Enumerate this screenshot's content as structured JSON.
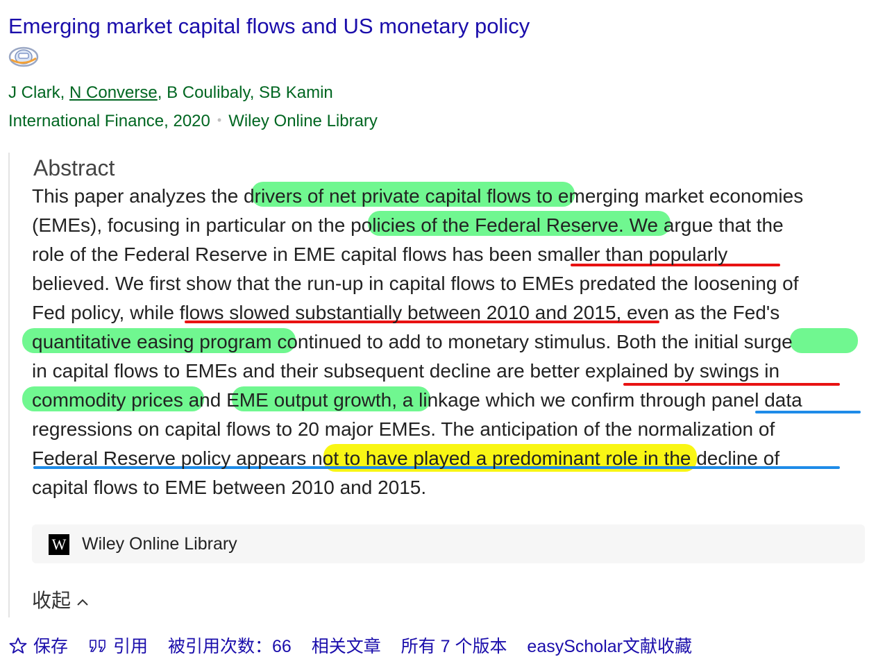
{
  "result": {
    "title": "Emerging market capital flows and US monetary policy",
    "authors": {
      "a1": "J Clark",
      "a2": "N Converse",
      "a3": "B Coulibaly",
      "a4": "SB Kamin",
      "sep": ", "
    },
    "venue": {
      "journal_year": "International Finance, 2020",
      "dot": "•",
      "library": "Wiley Online Library"
    }
  },
  "abstract": {
    "heading": "Abstract",
    "lines": [
      "This paper analyzes the drivers of net private capital flows to emerging market economies",
      "(EMEs), focusing in particular on the policies of the Federal Reserve. We argue that the",
      "role of the Federal Reserve in EME capital flows has been smaller than popularly",
      "believed. We first show that the run-up in capital flows to EMEs predated the loosening of",
      "Fed policy, while flows slowed substantially between 2010 and 2015, even as the Fed's",
      "quantitative easing program continued to add to monetary stimulus. Both the initial surge",
      "in capital flows to EMEs and their subsequent decline are better explained by swings in",
      "commodity prices and EME output growth, a linkage which we confirm through panel data",
      "regressions on capital flows to 20 major EMEs. The anticipation of the normalization of",
      "Federal Reserve policy appears not to have played a predominant role in the decline of",
      "capital flows to EME between 2010 and 2015."
    ]
  },
  "annotation_colors": {
    "green_highlight": "#50f578",
    "yellow_highlight": "#f8f500",
    "red_underline": "#e81212",
    "blue_underline": "#1e8be8"
  },
  "source": {
    "logo_letter": "W",
    "name": "Wiley Online Library"
  },
  "collapse_label": "收起",
  "footer": {
    "save": "保存",
    "cite": "引用",
    "cited_by": "被引用次数：66",
    "related": "相关文章",
    "versions": "所有 7 个版本",
    "easyscholar": "easyScholar文献收藏"
  },
  "icons": {
    "repository": "repository-globe-icon",
    "star": "star-icon",
    "quote": "quote-icon",
    "chevron": "chevron-up-icon"
  }
}
